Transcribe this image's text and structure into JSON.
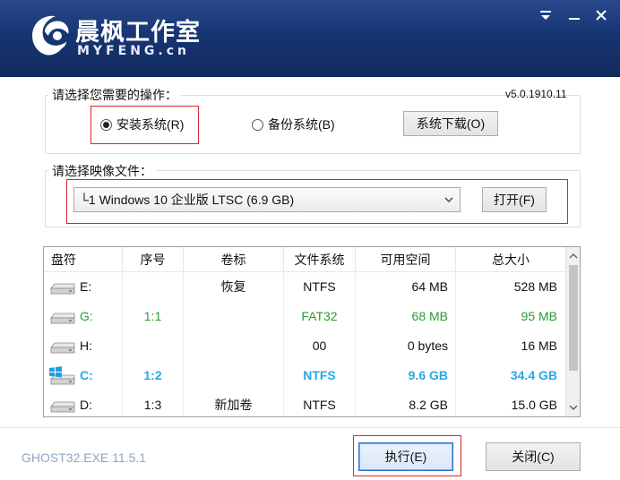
{
  "window": {
    "brand_title": "晨枫工作室",
    "brand_subtitle": "MYFENG.cn",
    "colors": {
      "header": "#16336f",
      "accent_blue": "#27a8e2",
      "accent_green": "#2e9a2e",
      "highlight_red": "#d9262b"
    }
  },
  "operation": {
    "legend": "请选择您需要的操作：",
    "version": "v5.0.1910.11",
    "install_label": "安装系统(R)",
    "backup_label": "备份系统(B)",
    "download_label": "系统下载(O)",
    "selected": "install"
  },
  "image": {
    "legend": "请选择映像文件：",
    "selected_image": "└1 Windows 10 企业版 LTSC (6.9 GB)",
    "open_label": "打开(F)"
  },
  "table": {
    "headers": [
      "盘符",
      "序号",
      "卷标",
      "文件系统",
      "可用空间",
      "总大小"
    ],
    "rows": [
      {
        "drive": "E:",
        "index": "",
        "label": "恢复",
        "fs": "NTFS",
        "free": "64 MB",
        "total": "528 MB",
        "style": "normal",
        "icon": "drive-icon"
      },
      {
        "drive": "G:",
        "index": "1:1",
        "label": "",
        "fs": "FAT32",
        "free": "68 MB",
        "total": "95 MB",
        "style": "green",
        "icon": "drive-icon"
      },
      {
        "drive": "H:",
        "index": "",
        "label": "",
        "fs": "00",
        "free": "0 bytes",
        "total": "16 MB",
        "style": "normal",
        "icon": "drive-icon"
      },
      {
        "drive": "C:",
        "index": "1:2",
        "label": "",
        "fs": "NTFS",
        "free": "9.6 GB",
        "total": "34.4 GB",
        "style": "blue",
        "icon": "windows-drive-icon"
      },
      {
        "drive": "D:",
        "index": "1:3",
        "label": "新加卷",
        "fs": "NTFS",
        "free": "8.2 GB",
        "total": "15.0 GB",
        "style": "normal",
        "icon": "drive-icon"
      }
    ]
  },
  "footer": {
    "ghost_version": "GHOST32.EXE 11.5.1",
    "execute_label": "执行(E)",
    "close_label": "关闭(C)"
  }
}
